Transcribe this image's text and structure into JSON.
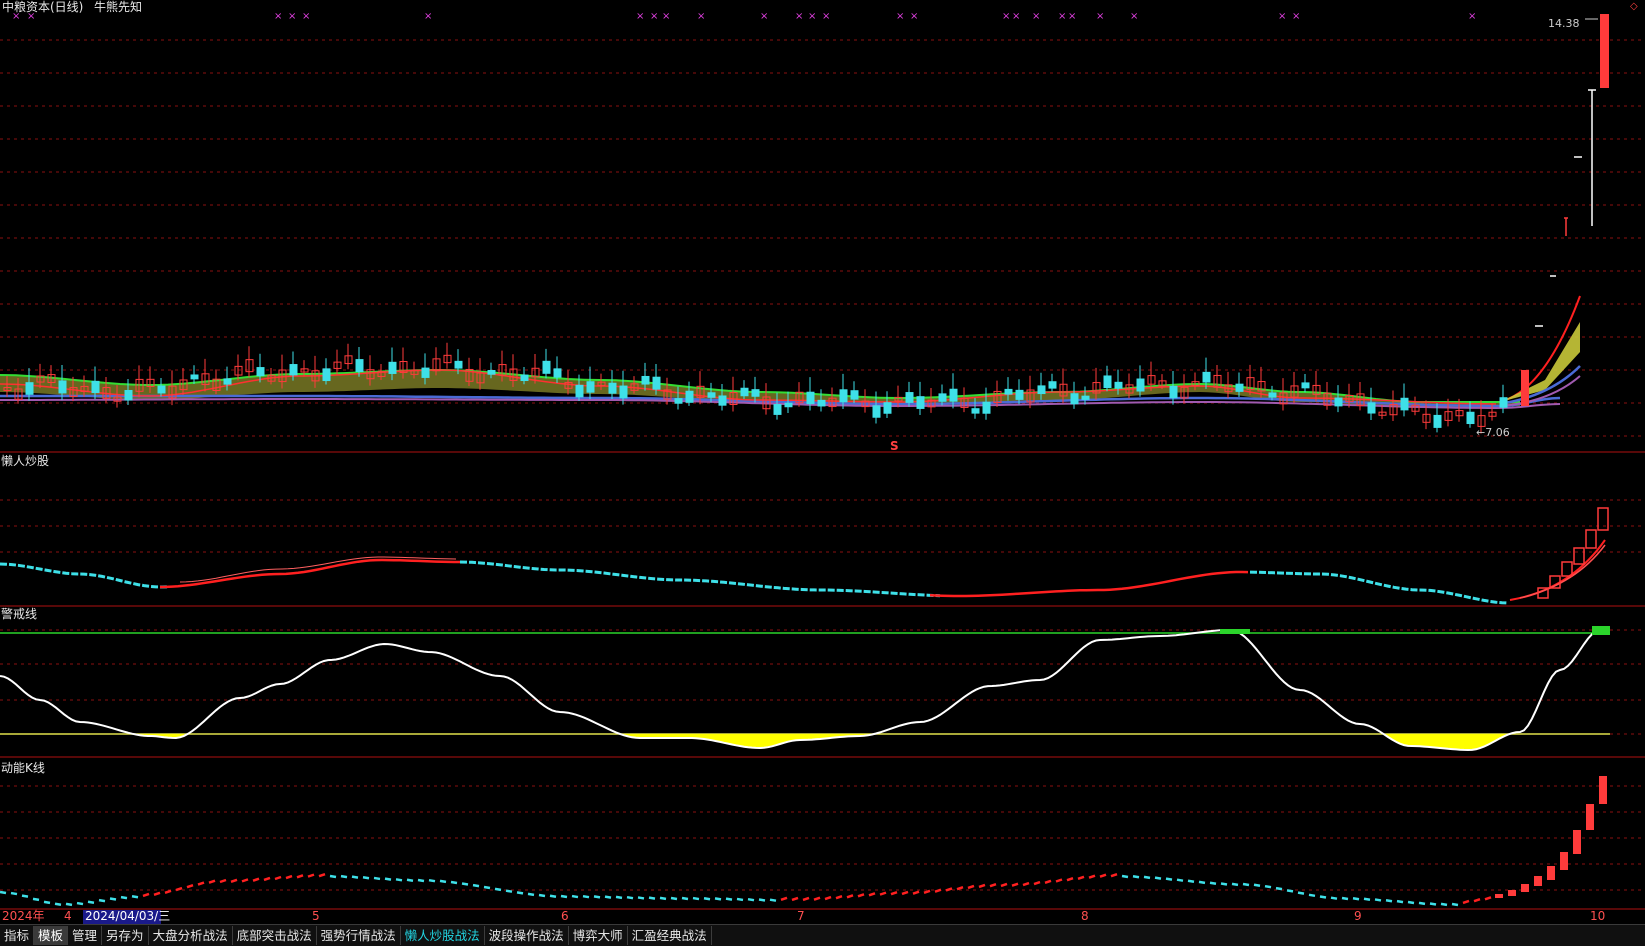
{
  "header": {
    "stock_title": "中粮资本(日线)",
    "indicator_title": "牛熊先知"
  },
  "main_panel": {
    "high_label": "14.38",
    "low_label": "←7.06",
    "signal_marker": "S",
    "corner_marker": "◇"
  },
  "panels": {
    "lazy": {
      "title": "懒人炒股"
    },
    "warning": {
      "title": "警戒线"
    },
    "kinetic": {
      "title": "动能K线"
    }
  },
  "time_axis": {
    "year_label": "2024年",
    "date_label": "2024/04/03/三",
    "months": [
      {
        "label": "4"
      },
      {
        "label": "5"
      },
      {
        "label": "6"
      },
      {
        "label": "7"
      },
      {
        "label": "8"
      },
      {
        "label": "9"
      },
      {
        "label": "10"
      }
    ]
  },
  "bottom_tabs": [
    {
      "label": "指标",
      "state": "normal"
    },
    {
      "label": "模板",
      "state": "active"
    },
    {
      "label": "管理",
      "state": "normal"
    },
    {
      "label": "另存为",
      "state": "normal"
    },
    {
      "label": "大盘分析战法",
      "state": "normal"
    },
    {
      "label": "底部突击战法",
      "state": "normal"
    },
    {
      "label": "强势行情战法",
      "state": "normal"
    },
    {
      "label": "懒人炒股战法",
      "state": "highlight"
    },
    {
      "label": "波段操作战法",
      "state": "normal"
    },
    {
      "label": "博弈大师",
      "state": "normal"
    },
    {
      "label": "汇盈经典战法",
      "state": "normal"
    }
  ],
  "colors": {
    "background": "#000000",
    "up": "#ff3b3b",
    "down": "#3ee0e8",
    "grid": "#8a0f0f",
    "ma_green": "#33dd33",
    "ma_yellow": "#c9c93a",
    "ma_blue": "#4a6bd6",
    "ma_purple": "#a05ab0",
    "warning_line": "#ffffff",
    "warning_fill": "#ffff00",
    "marker": "#e040e0"
  }
}
